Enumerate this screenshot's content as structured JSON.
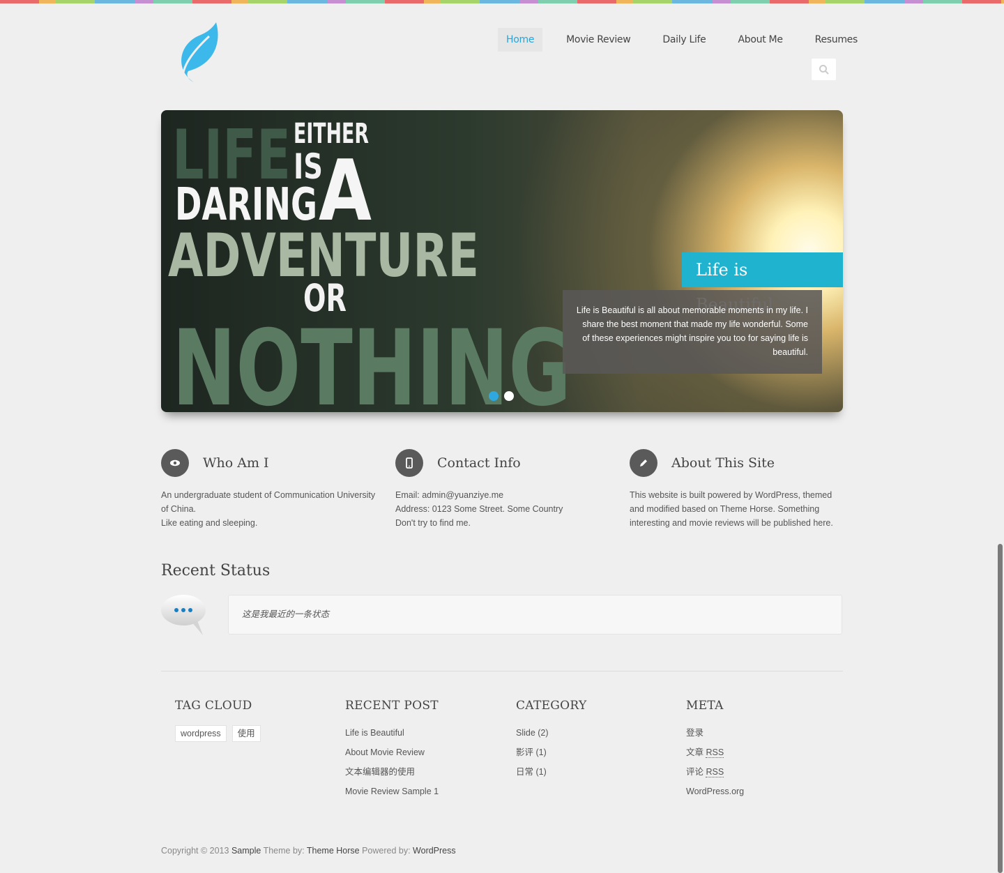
{
  "nav": {
    "items": [
      {
        "label": "Home"
      },
      {
        "label": "Movie Review"
      },
      {
        "label": "Daily Life"
      },
      {
        "label": "About Me"
      },
      {
        "label": "Resumes"
      }
    ]
  },
  "slider": {
    "image_text": {
      "line1": "LIFE",
      "either": "EITHER",
      "is": "IS",
      "daring": "DARING",
      "a": "A",
      "adventure": "ADVENTURE",
      "or": "OR",
      "nothing": "NOTHING"
    },
    "caption_title": "Life is Beautiful",
    "caption_body": "Life is Beautiful is all about memorable moments in my life. I share the best moment that made my life wonderful. Some of these experiences might inspire you too for saying life is beautiful."
  },
  "info": [
    {
      "title": "Who Am I",
      "lines": [
        "An undergraduate student of Communication University of China.",
        "Like eating and sleeping."
      ]
    },
    {
      "title": "Contact Info",
      "lines": [
        "Email:   admin@yuanziye.me",
        "Address:   0123 Some Street. Some Country",
        "Don't try to find me."
      ]
    },
    {
      "title": "About This Site",
      "lines": [
        "This website is built powered by WordPress, themed and modified based on Theme Horse. Something interesting and movie reviews will be published here."
      ]
    }
  ],
  "recent_status": {
    "title": "Recent Status",
    "text": "这是我最近的一条状态"
  },
  "footer": {
    "tag_cloud": {
      "title": "TAG CLOUD",
      "tags": [
        "wordpress",
        "使用"
      ]
    },
    "recent_post": {
      "title": "RECENT POST",
      "items": [
        "Life is Beautiful",
        "About Movie Review",
        "文本编辑器的使用",
        "Movie Review Sample 1"
      ]
    },
    "category": {
      "title": "CATEGORY",
      "items": [
        "Slide (2)",
        "影评 (1)",
        "日常 (1)"
      ]
    },
    "meta": {
      "title": "META",
      "login": "登录",
      "entries_prefix": "文章 ",
      "comments_prefix": "评论 ",
      "rss": "RSS",
      "wp": "WordPress.org"
    }
  },
  "copyright": {
    "prefix": "Copyright © 2013 ",
    "site": "Sample",
    "theme_by": " Theme by: ",
    "theme_horse": "Theme Horse",
    "powered_by": " Powered by: ",
    "wordpress": "WordPress"
  },
  "colors": {
    "accent": "#2aa4d8",
    "caption": "#1fb3cf",
    "logo": "#3cb8ea"
  }
}
